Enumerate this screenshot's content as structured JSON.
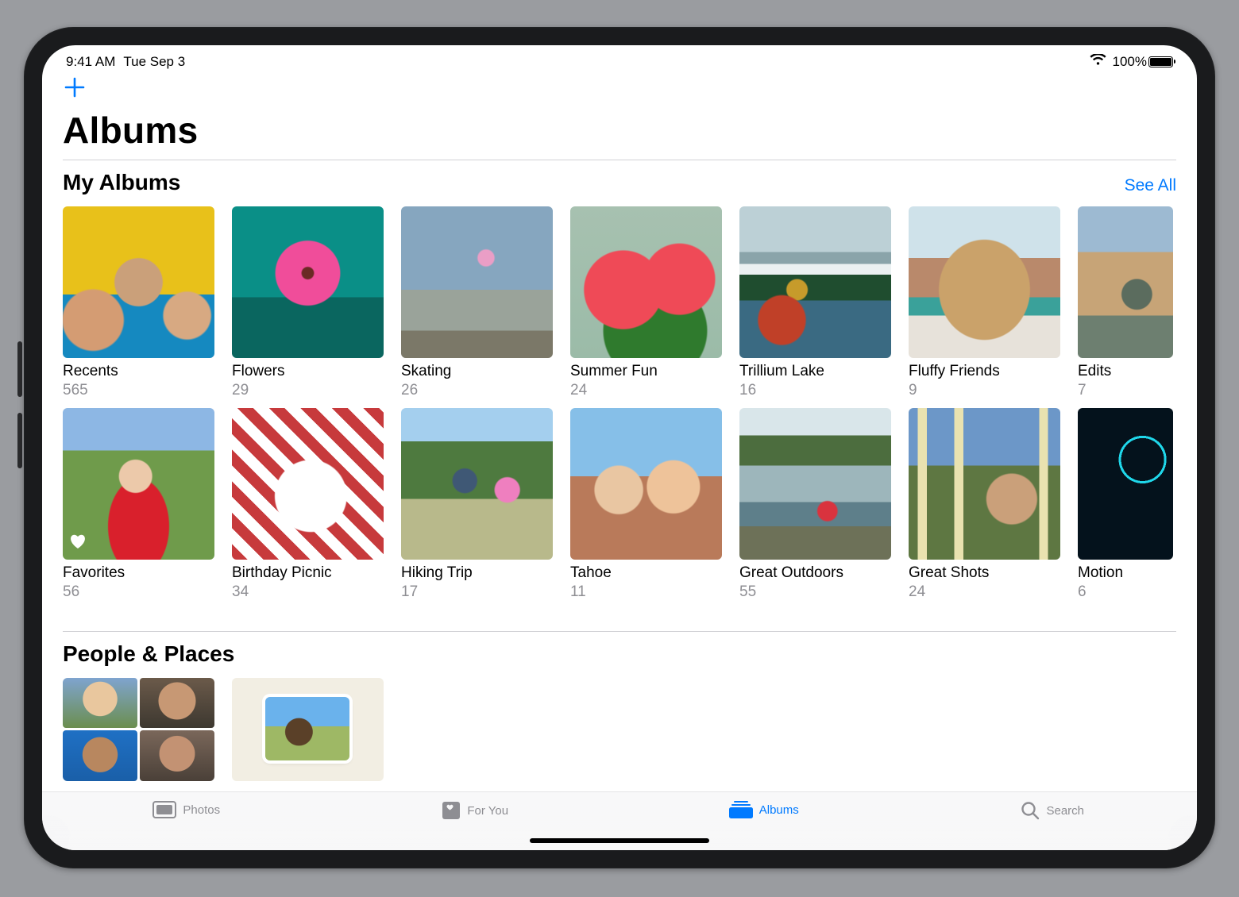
{
  "status": {
    "time": "9:41 AM",
    "date": "Tue Sep 3",
    "battery_pct": "100%"
  },
  "page_title": "Albums",
  "sections": {
    "my_albums": {
      "title": "My Albums",
      "see_all": "See All"
    },
    "people_places": {
      "title": "People & Places"
    }
  },
  "albums_row1": [
    {
      "title": "Recents",
      "count": "565",
      "thumb": "t-recents"
    },
    {
      "title": "Flowers",
      "count": "29",
      "thumb": "t-flowers"
    },
    {
      "title": "Skating",
      "count": "26",
      "thumb": "t-skating"
    },
    {
      "title": "Summer Fun",
      "count": "24",
      "thumb": "t-summer"
    },
    {
      "title": "Trillium Lake",
      "count": "16",
      "thumb": "t-trillium"
    },
    {
      "title": "Fluffy Friends",
      "count": "9",
      "thumb": "t-fluffy"
    },
    {
      "title": "Edits",
      "count": "7",
      "thumb": "t-edits",
      "partial": true
    }
  ],
  "albums_row2": [
    {
      "title": "Favorites",
      "count": "56",
      "thumb": "t-favorites",
      "favorite": true
    },
    {
      "title": "Birthday Picnic",
      "count": "34",
      "thumb": "t-picnic"
    },
    {
      "title": "Hiking Trip",
      "count": "17",
      "thumb": "t-hiking"
    },
    {
      "title": "Tahoe",
      "count": "11",
      "thumb": "t-tahoe"
    },
    {
      "title": "Great Outdoors",
      "count": "55",
      "thumb": "t-outdoors"
    },
    {
      "title": "Great Shots",
      "count": "24",
      "thumb": "t-shots"
    },
    {
      "title": "Motion",
      "count": "6",
      "thumb": "t-motion",
      "partial": true
    }
  ],
  "tabs": {
    "photos": "Photos",
    "for_you": "For You",
    "albums": "Albums",
    "search": "Search"
  }
}
